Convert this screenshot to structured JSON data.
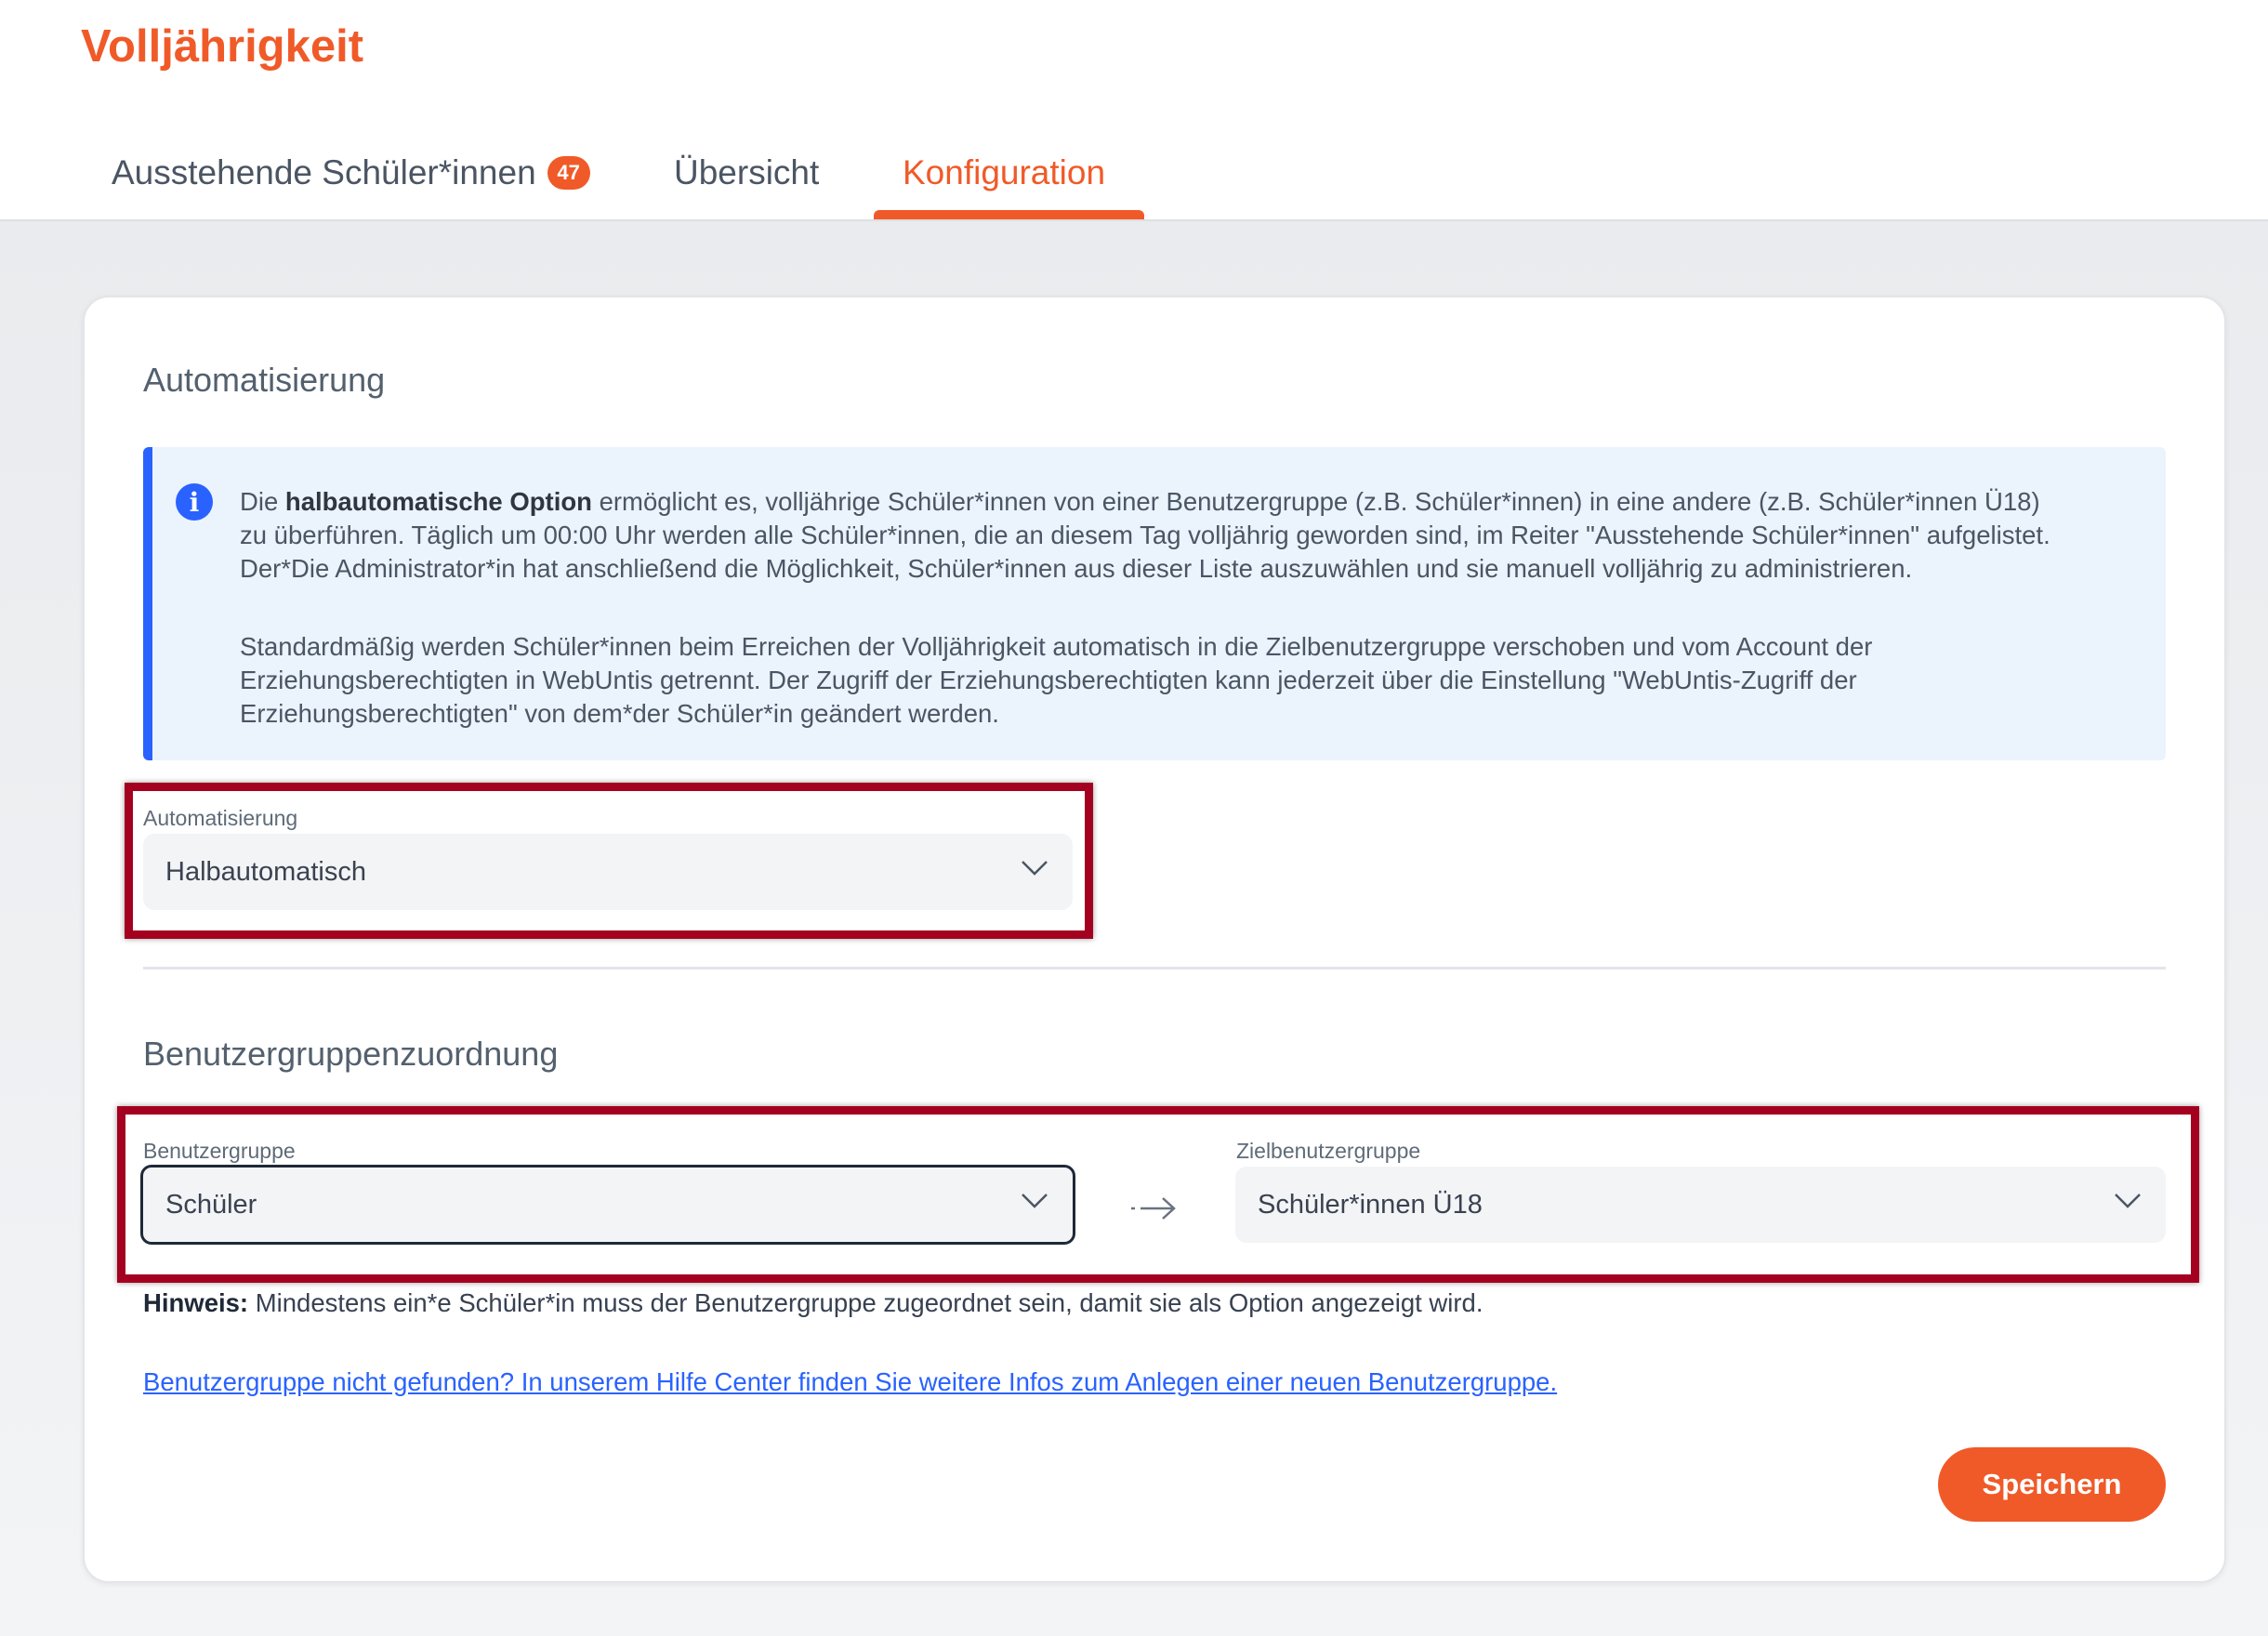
{
  "page": {
    "title": "Volljährigkeit"
  },
  "tabs": [
    {
      "label": "Ausstehende Schüler*innen",
      "badge": "47"
    },
    {
      "label": "Übersicht"
    },
    {
      "label": "Konfiguration",
      "active": true
    }
  ],
  "automation": {
    "title": "Automatisierung",
    "info": {
      "p1_prefix": "Die ",
      "p1_bold": "halbautomatische Option",
      "p1_line1_rest": " ermöglicht es, volljährige Schüler*innen von einer Benutzergruppe (z.B. Schüler*innen) in eine andere (z.B. Schüler*innen Ü18)",
      "p1_line2": "zu überführen. Täglich um 00:00 Uhr werden alle Schüler*innen, die an diesem Tag volljährig geworden sind, im Reiter \"Ausstehende Schüler*innen\" aufgelistet.",
      "p1_line3": "Der*Die Administrator*in hat anschließend die Möglichkeit, Schüler*innen aus dieser Liste auszuwählen und sie manuell volljährig zu administrieren.",
      "p2_line1": "Standardmäßig werden Schüler*innen beim Erreichen der Volljährigkeit automatisch in die Zielbenutzergruppe verschoben und vom Account der",
      "p2_line2": "Erziehungsberechtigten in WebUntis getrennt. Der Zugriff der Erziehungsberechtigten kann jederzeit über die Einstellung \"WebUntis-Zugriff der",
      "p2_line3": "Erziehungsberechtigten\" von dem*der Schüler*in geändert werden."
    },
    "field_label": "Automatisierung",
    "selected": "Halbautomatisch"
  },
  "mapping": {
    "title": "Benutzergruppenzuordnung",
    "source_label": "Benutzergruppe",
    "source_value": "Schüler",
    "target_label": "Zielbenutzergruppe",
    "target_value": "Schüler*innen Ü18",
    "hint_bold": "Hinweis:",
    "hint_text": " Mindestens ein*e Schüler*in muss der Benutzergruppe zugeordnet sein, damit sie als Option angezeigt wird.",
    "help_link": "Benutzergruppe nicht gefunden? In unserem Hilfe Center finden Sie weitere Infos zum Anlegen einer neuen Benutzergruppe."
  },
  "actions": {
    "save_label": "Speichern"
  },
  "colors": {
    "accent": "#f05a28",
    "info": "#2962ff",
    "highlight": "#a4001f"
  }
}
